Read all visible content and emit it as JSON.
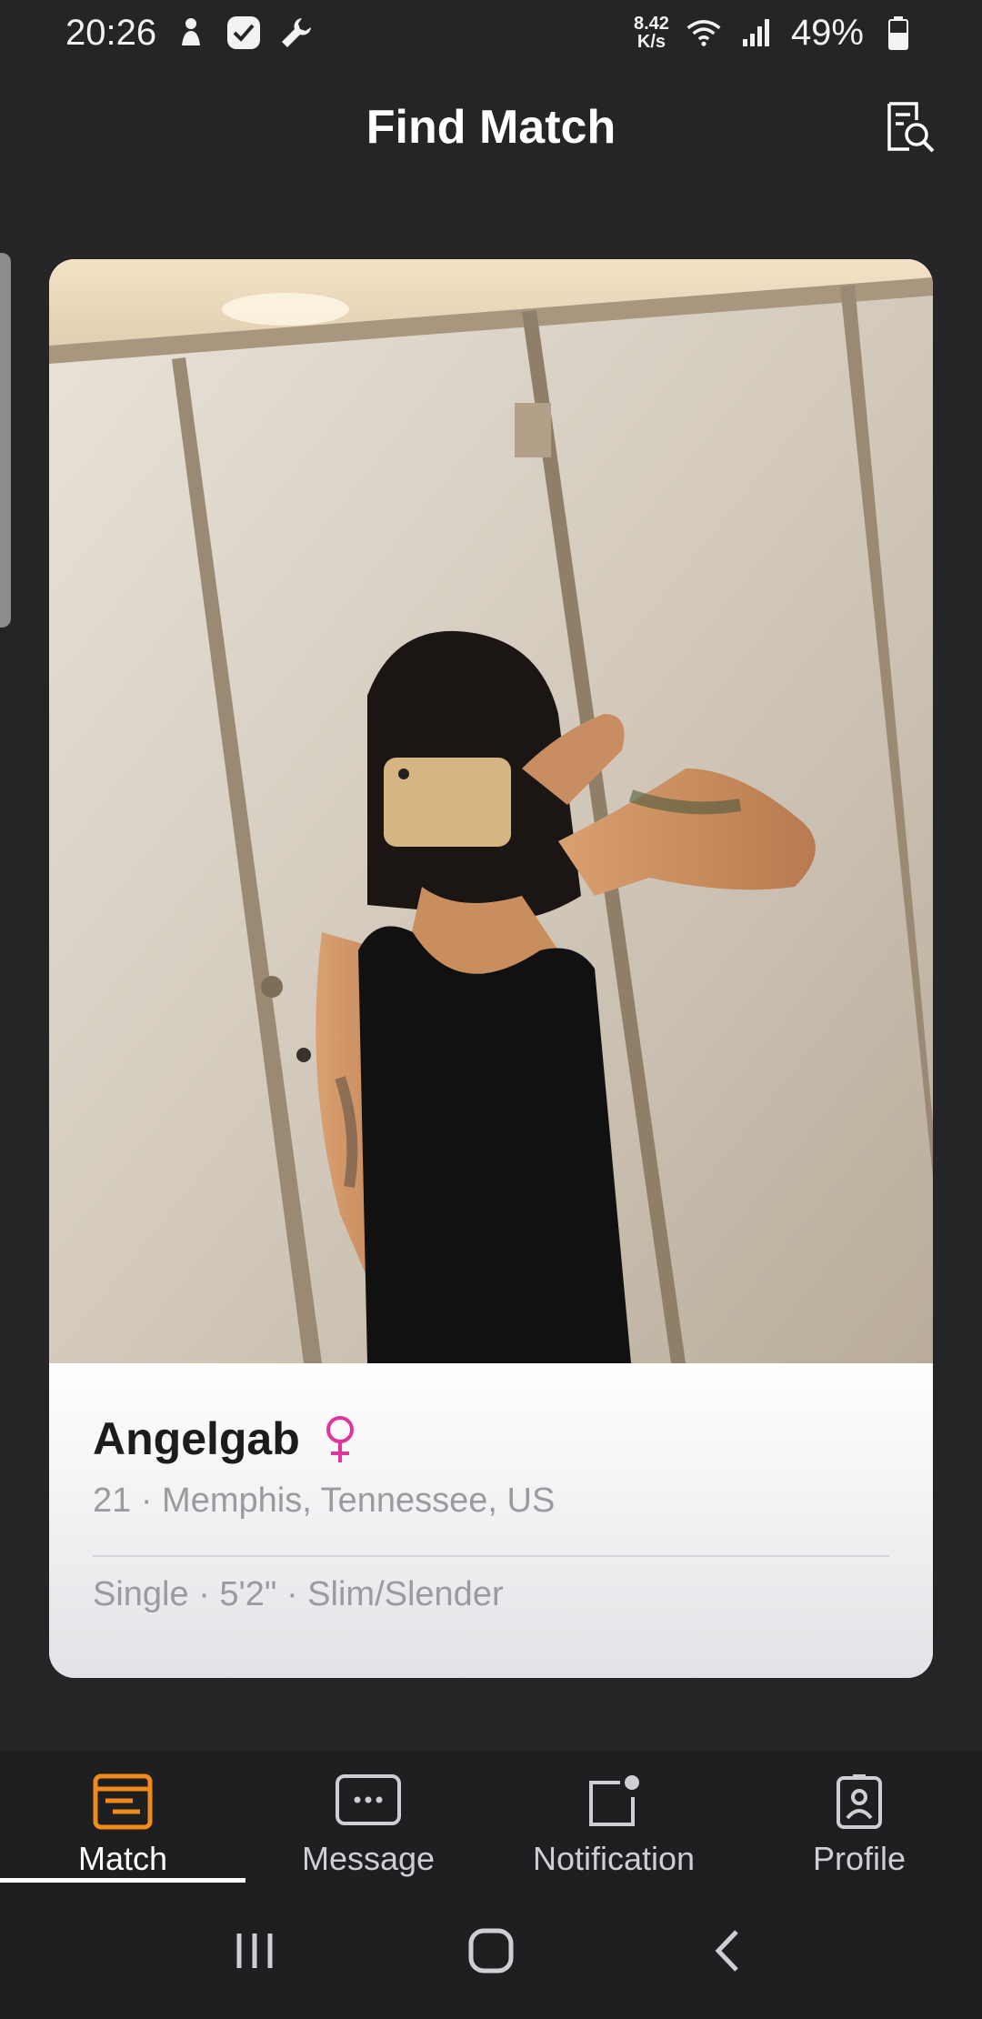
{
  "status_bar": {
    "time": "20:26",
    "net_speed_value": "8.42",
    "net_speed_unit": "K/s",
    "battery_percent": "49%",
    "icons": [
      "person-icon",
      "check-icon",
      "wrench-icon",
      "wifi-icon",
      "signal-icon",
      "battery-icon"
    ]
  },
  "header": {
    "title": "Find Match",
    "action_icon": "search-profiles-icon"
  },
  "card": {
    "name": "Angelgab",
    "gender_icon": "female-icon",
    "location": "21 · Memphis, Tennessee, US",
    "attributes": "Single · 5'2\" · Slim/Slender",
    "accent_color": "#e0359a"
  },
  "bottom_nav": {
    "active_color": "#f08a1c",
    "items": [
      {
        "label": "Match",
        "icon": "match-icon",
        "active": true
      },
      {
        "label": "Message",
        "icon": "message-icon",
        "active": false
      },
      {
        "label": "Notification",
        "icon": "notification-icon",
        "active": false
      },
      {
        "label": "Profile",
        "icon": "profile-icon",
        "active": false
      }
    ]
  },
  "system_nav": {
    "icons": [
      "recents-icon",
      "home-icon",
      "back-icon"
    ]
  }
}
